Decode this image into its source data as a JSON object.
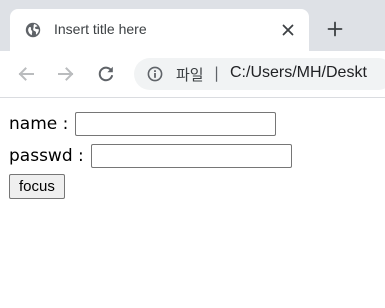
{
  "browser": {
    "tab": {
      "title": "Insert title here",
      "favicon_icon": "globe-icon",
      "close_icon": "close-icon"
    },
    "new_tab_icon": "plus-icon",
    "toolbar": {
      "back_icon": "arrow-left-icon",
      "forward_icon": "arrow-right-icon",
      "reload_icon": "reload-icon",
      "omnibox": {
        "info_icon": "info-icon",
        "scheme_label": "파일",
        "separator": "|",
        "url": "C:/Users/MH/Deskt"
      }
    }
  },
  "form": {
    "name_label": "name :",
    "name_value": "",
    "passwd_label": "passwd :",
    "passwd_value": "",
    "focus_button_label": "focus"
  },
  "colors": {
    "tabstrip_bg": "#dee1e6",
    "omnibox_bg": "#f1f3f4",
    "button_bg": "#efefef"
  }
}
